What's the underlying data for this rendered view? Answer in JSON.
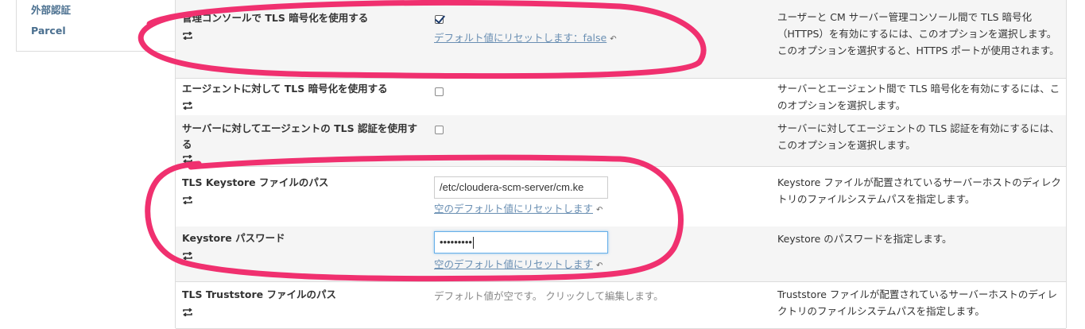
{
  "nav": {
    "items": [
      {
        "label": "外部認証"
      },
      {
        "label": "Parcel"
      }
    ]
  },
  "rows": [
    {
      "label": "管理コンソールで TLS 暗号化を使用する",
      "checked": true,
      "reset_label": "デフォルト値にリセットします：false",
      "description": "ユーザーと CM サーバー管理コンソール間で TLS 暗号化（HTTPS）を有効にするには、このオプションを選択します。このオプションを選択すると、HTTPS ポートが使用されます。"
    },
    {
      "label": "エージェントに対して TLS 暗号化を使用する",
      "checked": false,
      "description": "サーバーとエージェント間で TLS 暗号化を有効にするには、このオプションを選択します。"
    },
    {
      "label": "サーバーに対してエージェントの TLS 認証を使用する",
      "checked": false,
      "description": "サーバーに対してエージェントの TLS 認証を有効にするには、このオプションを選択します。"
    },
    {
      "label": "TLS Keystore ファイルのパス",
      "value": "/etc/cloudera-scm-server/cm.ke",
      "reset_label": "空のデフォルト値にリセットします",
      "description": "Keystore ファイルが配置されているサーバーホストのディレクトリのファイルシステムパスを指定します。"
    },
    {
      "label": "Keystore パスワード",
      "value": "•••••••••",
      "reset_label": "空のデフォルト値にリセットします",
      "description": "Keystore のパスワードを指定します。"
    },
    {
      "label": "TLS Truststore ファイルのパス",
      "empty_text": "デフォルト値が空です。 クリックして編集します。",
      "description": "Truststore ファイルが配置されているサーバーホストのディレクトリのファイルシステムパスを指定します。"
    }
  ],
  "colors": {
    "annotation": "#f0306f",
    "link": "#6a8fb3",
    "nav_text": "#4a6f8f"
  },
  "icons": {
    "reset": "reset-icon",
    "undo": "undo-arrow-icon"
  }
}
